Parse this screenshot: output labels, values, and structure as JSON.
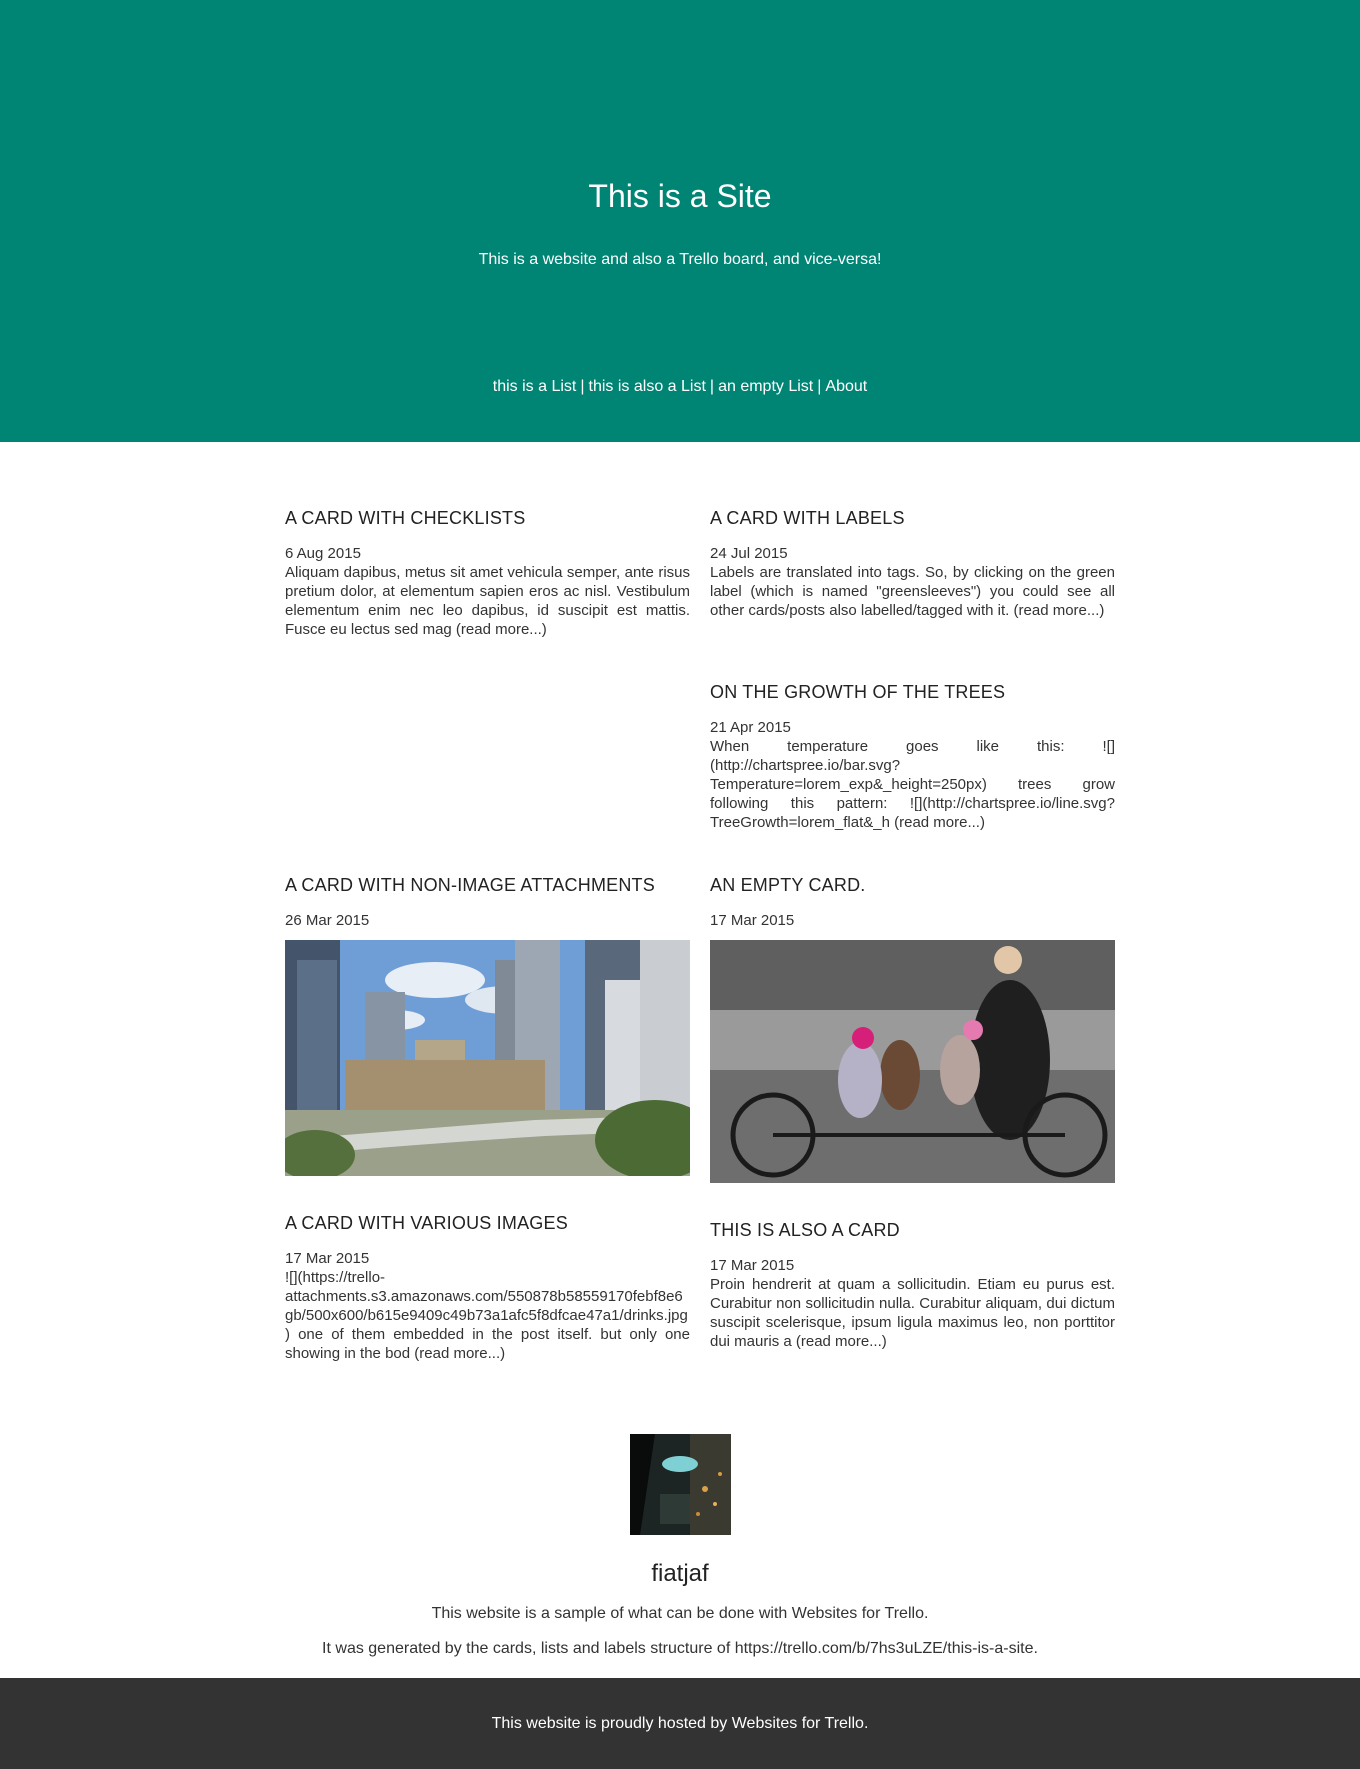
{
  "header": {
    "title": "This is a Site",
    "subtitle": "This is a website and also a Trello board, and vice-versa!"
  },
  "nav": {
    "items": [
      "this is a List",
      "this is also a List",
      "an empty List",
      "About"
    ],
    "separator": "|"
  },
  "cards": [
    {
      "title": "A CARD WITH CHECKLISTS",
      "date": "6 Aug 2015",
      "excerpt": "Aliquam dapibus, metus sit amet vehicula semper, ante risus pretium dolor, at elementum sapien eros ac nisl. Vestibulum elementum enim nec leo dapibus, id suscipit est mattis. Fusce eu lectus sed mag ",
      "more": "(read more...)"
    },
    {
      "title": "A CARD WITH LABELS",
      "date": "24 Jul 2015",
      "excerpt": "Labels are translated into tags. So, by clicking on the green label (which is named \"greensleeves\") you could see all other cards/posts also labelled/tagged with it. ",
      "more": "(read more...)"
    },
    {
      "title": "ON THE GROWTH OF THE TREES",
      "date": "21 Apr 2015",
      "excerpt": "When temperature goes like this: ![](http://chartspree.io/bar.svg?Temperature=lorem_exp&_height=250px) trees grow following this pattern: ![](http://chartspree.io/line.svg?TreeGrowth=lorem_flat&_h ",
      "more": "(read more...)"
    },
    {
      "title": "A CARD WITH NON-IMAGE ATTACHMENTS",
      "date": "26 Mar 2015"
    },
    {
      "title": "AN EMPTY CARD.",
      "date": "17 Mar 2015"
    },
    {
      "title": "A CARD WITH VARIOUS IMAGES",
      "date": "17 Mar 2015",
      "excerpt": "![](https://trello-attachments.s3.amazonaws.com/550878b58559170febf8e6gb/500x600/b615e9409c49b73a1afc5f8dfcae47a1/drinks.jpg) one of them embedded in the post itself. but only one showing in the bod ",
      "more": "(read more...)"
    },
    {
      "title": "THIS IS ALSO A CARD",
      "date": "17 Mar 2015",
      "excerpt": "Proin hendrerit at quam a sollicitudin. Etiam eu purus est. Curabitur non sollicitudin nulla. Curabitur aliquam, dui dictum suscipit scelerisque, ipsum ligula maximus leo, non porttitor dui mauris a ",
      "more": "(read more...)"
    }
  ],
  "author": {
    "name": "fiatjaf",
    "about_line1": "This website is a sample of what can be done with Websites for Trello.",
    "about_line2": "It was generated by the cards, lists and labels structure of https://trello.com/b/7hs3uLZE/this-is-a-site."
  },
  "footer": {
    "prefix": "This website is proudly hosted by ",
    "link": "Websites for Trello",
    "suffix": "."
  },
  "colors": {
    "header_bg": "#008474",
    "footer_bg": "#333333"
  }
}
